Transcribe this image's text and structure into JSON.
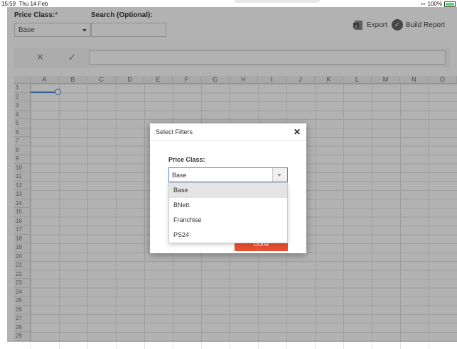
{
  "status": {
    "time": "15:59",
    "date": "Thu 14 Feb",
    "battery": "100%"
  },
  "filters": {
    "price_class_label": "Price Class:",
    "price_class_value": "Base",
    "search_label": "Search (Optional):",
    "search_value": ""
  },
  "actions": {
    "export_label": "Export",
    "build_label": "Build Report"
  },
  "toolbar": {
    "cancel_icon": "x-icon",
    "confirm_icon": "check-icon"
  },
  "sheet": {
    "columns": [
      "A",
      "B",
      "C",
      "D",
      "E",
      "F",
      "G",
      "H",
      "I",
      "J",
      "K",
      "L",
      "M",
      "N",
      "O"
    ],
    "rows": [
      "1",
      "2",
      "3",
      "4",
      "5",
      "6",
      "7",
      "8",
      "9",
      "10",
      "11",
      "12",
      "13",
      "14",
      "15",
      "16",
      "17",
      "18",
      "19",
      "20",
      "21",
      "22",
      "23",
      "24",
      "25",
      "26",
      "27",
      "28",
      "29"
    ]
  },
  "modal": {
    "title": "Select Filters",
    "field_label": "Price Class:",
    "selected": "Base",
    "options": [
      "Base",
      "BNett",
      "Franchise",
      "PS24"
    ],
    "done_label": "Done"
  },
  "colors": {
    "accent": "#e8502f",
    "selection": "#4a89dc",
    "battery": "#4cd964"
  }
}
